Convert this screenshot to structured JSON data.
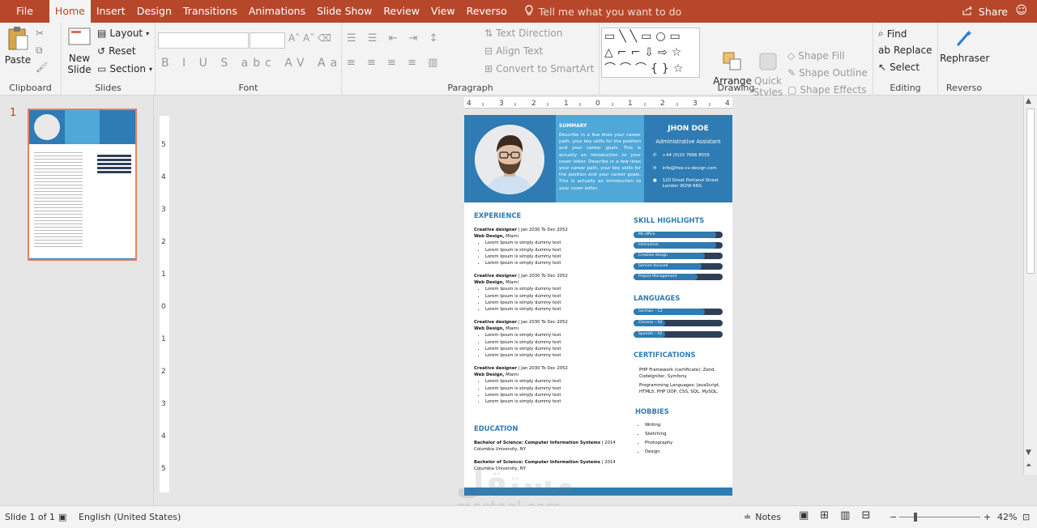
{
  "tabs": [
    {
      "label": "File",
      "active": false
    },
    {
      "label": "Home",
      "active": true
    },
    {
      "label": "Insert",
      "active": false
    },
    {
      "label": "Design",
      "active": false
    },
    {
      "label": "Transitions",
      "active": false
    },
    {
      "label": "Animations",
      "active": false
    },
    {
      "label": "Slide Show",
      "active": false
    },
    {
      "label": "Review",
      "active": false
    },
    {
      "label": "View",
      "active": false
    },
    {
      "label": "Reverso",
      "active": false
    }
  ],
  "tell_me": "Tell me what you want to do",
  "share": "Share",
  "ribbon": {
    "clipboard": {
      "label": "Clipboard",
      "paste": "Paste"
    },
    "slides": {
      "label": "Slides",
      "new_slide": "New Slide",
      "layout": "Layout",
      "reset": "Reset",
      "section": "Section"
    },
    "font": {
      "label": "Font"
    },
    "paragraph": {
      "label": "Paragraph",
      "text_direction": "Text Direction",
      "align_text": "Align Text",
      "smartart": "Convert to SmartArt"
    },
    "drawing": {
      "label": "Drawing",
      "arrange": "Arrange",
      "quick_styles": "Quick Styles",
      "shape_fill": "Shape Fill",
      "shape_outline": "Shape Outline",
      "shape_effects": "Shape Effects"
    },
    "editing": {
      "label": "Editing",
      "find": "Find",
      "replace": "Replace",
      "select": "Select"
    },
    "reverso": {
      "label": "Reverso",
      "rephraser": "Rephraser"
    }
  },
  "thumbs": {
    "slide_number": "1"
  },
  "resume": {
    "summary_title": "SUMMARY",
    "summary_text": "Describe in a few lines your career path, your key skills for the position and your career goals. This is actually an introduction to your cover letter. Describe in a few lines your career path, your key skills for the position and your career goals. This is actually an introduction to your cover letter.",
    "name": "JHON DOE",
    "role": "Administrative Assistant",
    "phone": "+44 (0)20 7666 8555",
    "email": "info@free-cv-design.com",
    "address_1": "120 Great Portland Street",
    "address_2": "London W2W 6RG",
    "experience_title": "EXPERIENCE",
    "jobs": [
      {
        "title": "Creative designer",
        "dates": " | Jan 2030 To Dec 2052",
        "company": "Web Design,",
        "city": " Miami",
        "items": [
          "Lorem Ipsum is simply dummy text",
          "Lorem Ipsum is simply dummy text",
          "Lorem Ipsum is simply dummy text",
          "Lorem Ipsum is simply dummy text"
        ]
      },
      {
        "title": "Creative designer",
        "dates": " | Jan 2030 To Dec 2052",
        "company": "Web Design,",
        "city": " Miami",
        "items": [
          "Lorem Ipsum is simply dummy text",
          "Lorem Ipsum is simply dummy text",
          "Lorem Ipsum is simply dummy text",
          "Lorem Ipsum is simply dummy text"
        ]
      },
      {
        "title": "Creative designer",
        "dates": " | Jan 2030 To Dec 2052",
        "company": "Web Design,",
        "city": " Miami",
        "items": [
          "Lorem Ipsum is simply dummy text",
          "Lorem Ipsum is simply dummy text",
          "Lorem Ipsum is simply dummy text",
          "Lorem Ipsum is simply dummy text"
        ]
      },
      {
        "title": "Creative designer",
        "dates": " | Jan 2030 To Dec 2052",
        "company": "Web Design,",
        "city": " Miami",
        "items": [
          "Lorem Ipsum is simply dummy text",
          "Lorem Ipsum is simply dummy text",
          "Lorem Ipsum is simply dummy text",
          "Lorem Ipsum is simply dummy text"
        ]
      }
    ],
    "education_title": "EDUCATION",
    "education": [
      {
        "degree": "Bachelor of Science: Computer Information Systems",
        "year": " | 2014",
        "school": "Columbia University, NY"
      },
      {
        "degree": "Bachelor of Science: Computer Information Systems",
        "year": " | 2014",
        "school": "Columbia University, NY"
      }
    ],
    "skills_title": "SKILL HIGHLIGHTS",
    "skills": [
      {
        "label": "Ms office",
        "level": 0.93
      },
      {
        "label": "Interactive",
        "level": 0.93
      },
      {
        "label": "Creative design",
        "level": 0.8
      },
      {
        "label": "Service focused",
        "level": 0.76
      },
      {
        "label": "Project Management",
        "level": 0.72
      }
    ],
    "languages_title": "LANGUAGES",
    "languages": [
      {
        "label": "German – C2",
        "level": 0.8
      },
      {
        "label": "Chinese – A2",
        "level": 0.35
      },
      {
        "label": "Spanish – A2",
        "level": 0.35
      }
    ],
    "certifications_title": "CERTIFICATIONS",
    "cert_1": "PHP Framework (certificate): Zend, CodeIgniter, Symfony.",
    "cert_2": "Programming Languages: JavaScript, HTML5, PHP OOP, CSS, SQL, MySQL.",
    "hobbies_title": "HOBBIES",
    "hobbies": [
      "Writing",
      "Sketching",
      "Photography",
      "Design"
    ]
  },
  "watermark": {
    "arabic": "مستقل",
    "latin": "mostaql.com"
  },
  "status": {
    "slide_of": "Slide 1 of 1",
    "language": "English (United States)",
    "notes": "Notes",
    "zoom": "42%"
  },
  "colors": {
    "accent": "#b7472a",
    "resume_blue": "#2e7cb3",
    "summary_blue": "#4fa8d8",
    "bar_track": "#2f3f56"
  }
}
